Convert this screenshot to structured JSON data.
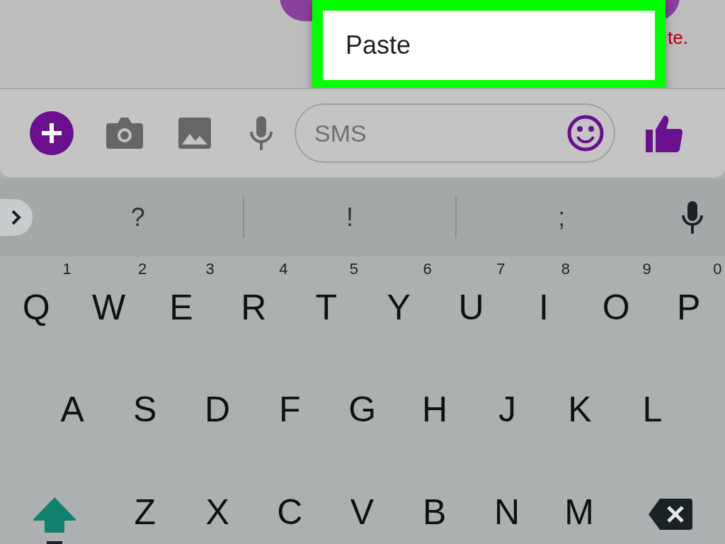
{
  "message": {
    "status_text": "te."
  },
  "context_menu": {
    "items": [
      {
        "label": "Paste"
      }
    ]
  },
  "compose": {
    "placeholder": "SMS"
  },
  "suggestions": [
    "?",
    "!",
    ";"
  ],
  "keyboard": {
    "shift_on": true,
    "rows": [
      [
        {
          "key": "Q",
          "hint": "1"
        },
        {
          "key": "W",
          "hint": "2"
        },
        {
          "key": "E",
          "hint": "3"
        },
        {
          "key": "R",
          "hint": "4"
        },
        {
          "key": "T",
          "hint": "5"
        },
        {
          "key": "Y",
          "hint": "6"
        },
        {
          "key": "U",
          "hint": "7"
        },
        {
          "key": "I",
          "hint": "8"
        },
        {
          "key": "O",
          "hint": "9"
        },
        {
          "key": "P",
          "hint": "0"
        }
      ],
      [
        {
          "key": "A"
        },
        {
          "key": "S"
        },
        {
          "key": "D"
        },
        {
          "key": "F"
        },
        {
          "key": "G"
        },
        {
          "key": "H"
        },
        {
          "key": "J"
        },
        {
          "key": "K"
        },
        {
          "key": "L"
        }
      ],
      [
        {
          "key": "Z"
        },
        {
          "key": "X"
        },
        {
          "key": "C"
        },
        {
          "key": "V"
        },
        {
          "key": "B"
        },
        {
          "key": "N"
        },
        {
          "key": "M"
        }
      ]
    ]
  }
}
